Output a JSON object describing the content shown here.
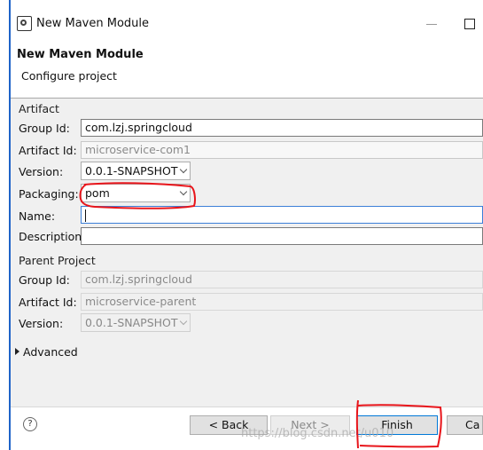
{
  "window": {
    "title": "New Maven Module",
    "icon": "eclipse-gear-icon"
  },
  "header": {
    "title": "New Maven Module",
    "subtitle": "Configure project"
  },
  "artifact": {
    "section_label": "Artifact",
    "group_id": {
      "label": "Group Id:",
      "value": "com.lzj.springcloud"
    },
    "artifact_id": {
      "label": "Artifact Id:",
      "value": "microservice-com1"
    },
    "version": {
      "label": "Version:",
      "value": "0.0.1-SNAPSHOT"
    },
    "packaging": {
      "label": "Packaging:",
      "value": "pom"
    },
    "name": {
      "label": "Name:",
      "value": ""
    },
    "description": {
      "label": "Description:",
      "value": ""
    }
  },
  "parent": {
    "section_label": "Parent Project",
    "group_id": {
      "label": "Group Id:",
      "value": "com.lzj.springcloud"
    },
    "artifact_id": {
      "label": "Artifact Id:",
      "value": "microservice-parent"
    },
    "version": {
      "label": "Version:",
      "value": "0.0.1-SNAPSHOT"
    }
  },
  "advanced": {
    "label": "Advanced"
  },
  "buttons": {
    "help": "?",
    "back": "< Back",
    "next": "Next >",
    "finish": "Finish",
    "cancel": "Ca"
  },
  "watermark": "https://blog.csdn.net/u010"
}
